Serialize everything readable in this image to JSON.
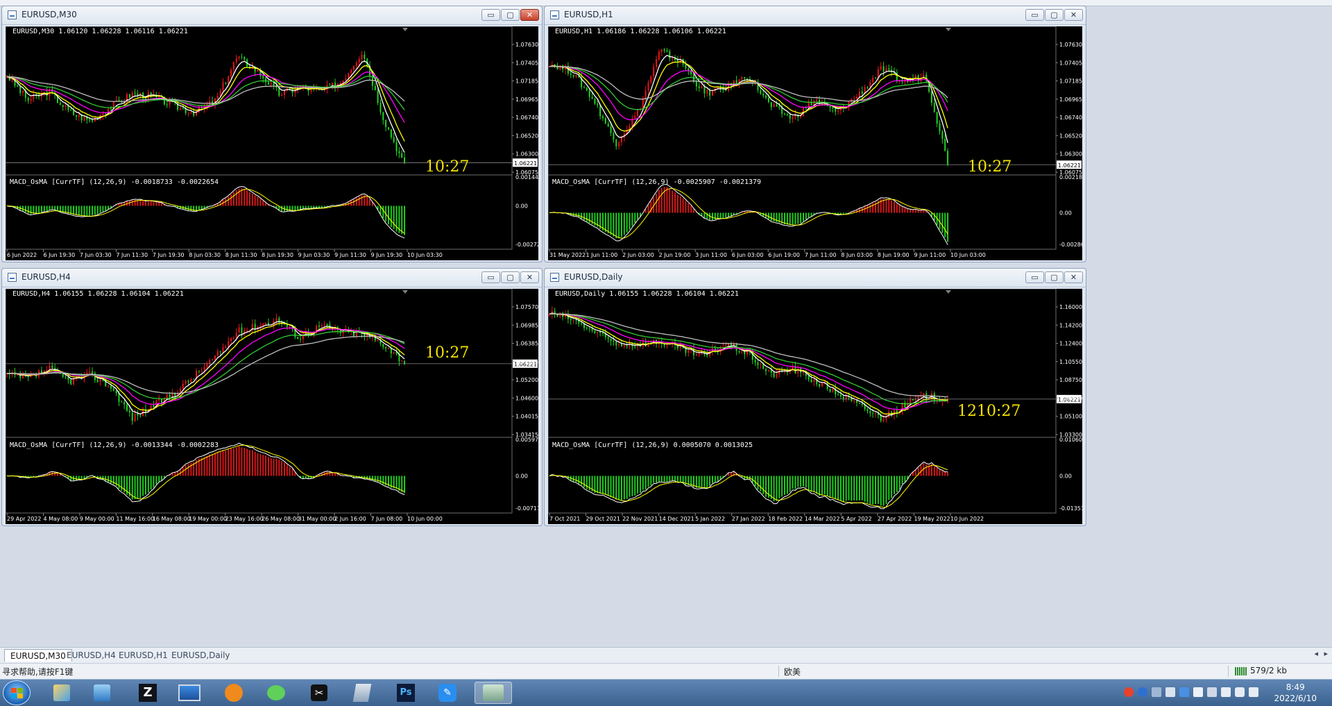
{
  "colors": {
    "bull": "#e8141a",
    "bear": "#22d323",
    "white": "#ffffff",
    "yellow": "#ffff00",
    "magenta": "#ff00ff",
    "green": "#33cc33",
    "gray": "#bfbfbf",
    "hist_up": "#d81818",
    "hist_dn": "#22cc22",
    "timer": "#f3e300"
  },
  "windows": [
    {
      "title": "EURUSD,M30",
      "info": "EURUSD,M30  1.06120 1.06228 1.06116 1.06221",
      "macd_label": "MACD_OsMA [CurrTF] (12,26,9) -0.0018733 -0.0022654",
      "timer": "10:27",
      "price_current": "1.06221",
      "price_ticks": [
        "1.07630",
        "1.07405",
        "1.07185",
        "1.06965",
        "1.06740",
        "1.06520",
        "1.06300",
        "1.06075"
      ],
      "macd_ticks": [
        "0.0014461",
        "0.00",
        "-0.0027253"
      ],
      "time_ticks": [
        "6 Jun 2022",
        "6 Jun 19:30",
        "7 Jun 03:30",
        "7 Jun 11:30",
        "7 Jun 19:30",
        "8 Jun 03:30",
        "8 Jun 11:30",
        "8 Jun 19:30",
        "9 Jun 03:30",
        "9 Jun 11:30",
        "9 Jun 19:30",
        "10 Jun 03:30"
      ]
    },
    {
      "title": "EURUSD,H1",
      "info": "EURUSD,H1  1.06186 1.06228 1.06106 1.06221",
      "macd_label": "MACD_OsMA [CurrTF] (12,26,9) -0.0025907 -0.0021379",
      "timer": "10:27",
      "price_current": "1.06221",
      "price_ticks": [
        "1.07630",
        "1.07405",
        "1.07185",
        "1.06965",
        "1.06740",
        "1.06520",
        "1.06300",
        "1.06075"
      ],
      "macd_ticks": [
        "0.0021886",
        "0.00",
        "-0.0028646"
      ],
      "time_ticks": [
        "31 May 2022",
        "1 Jun 11:00",
        "2 Jun 03:00",
        "2 Jun 19:00",
        "3 Jun 11:00",
        "6 Jun 03:00",
        "6 Jun 19:00",
        "7 Jun 11:00",
        "8 Jun 03:00",
        "8 Jun 19:00",
        "9 Jun 11:00",
        "10 Jun 03:00"
      ]
    },
    {
      "title": "EURUSD,H4",
      "info": "EURUSD,H4  1.06155 1.06228 1.06104 1.06221",
      "macd_label": "MACD_OsMA [CurrTF] (12,26,9) -0.0013344 -0.0002283",
      "timer": "10:27",
      "price_current": "1.06221",
      "price_ticks": [
        "1.07570",
        "1.06985",
        "1.06385",
        "1.05785",
        "1.05200",
        "1.04600",
        "1.04015",
        "1.03415"
      ],
      "macd_ticks": [
        "0.0059779",
        "0.00",
        "-0.0071767"
      ],
      "time_ticks": [
        "29 Apr 2022",
        "4 May 08:00",
        "9 May 00:00",
        "11 May 16:00",
        "16 May 08:00",
        "19 May 00:00",
        "23 May 16:00",
        "26 May 08:00",
        "31 May 00:00",
        "2 Jun 16:00",
        "7 Jun 08:00",
        "10 Jun 00:00"
      ]
    },
    {
      "title": "EURUSD,Daily",
      "info": "EURUSD,Daily  1.06155 1.06228 1.06104 1.06221",
      "macd_label": "MACD_OsMA [CurrTF] (12,26,9) 0.0005070 0.0013025",
      "timer": "1210:27",
      "price_current": "1.06221",
      "price_ticks": [
        "1.16000",
        "1.14200",
        "1.12400",
        "1.10550",
        "1.08750",
        "1.06900",
        "1.05100",
        "1.03300"
      ],
      "macd_ticks": [
        "0.0106004",
        "0.00",
        "-0.0135151"
      ],
      "time_ticks": [
        "7 Oct 2021",
        "29 Oct 2021",
        "22 Nov 2021",
        "14 Dec 2021",
        "5 Jan 2022",
        "27 Jan 2022",
        "18 Feb 2022",
        "14 Mar 2022",
        "5 Apr 2022",
        "27 Apr 2022",
        "19 May 2022",
        "10 Jun 2022"
      ]
    }
  ],
  "tabs": [
    "EURUSD,M30",
    "EURUSD,H4",
    "EURUSD,H1",
    "EURUSD,Daily"
  ],
  "status": {
    "help": "寻求帮助,请按F1键",
    "profile": "欧美",
    "traffic": "579/2 kb"
  },
  "clock": {
    "time": "8:49",
    "date": "2022/6/10"
  },
  "taskbar_icons": [
    "start-icon",
    "paint-icon",
    "users-icon",
    "z-app-icon",
    "desktop-icon",
    "orange-app-icon",
    "wechat-icon",
    "capcut-icon",
    "notes-icon",
    "photoshop-icon",
    "pen-app-icon",
    "metatrader-icon"
  ]
}
